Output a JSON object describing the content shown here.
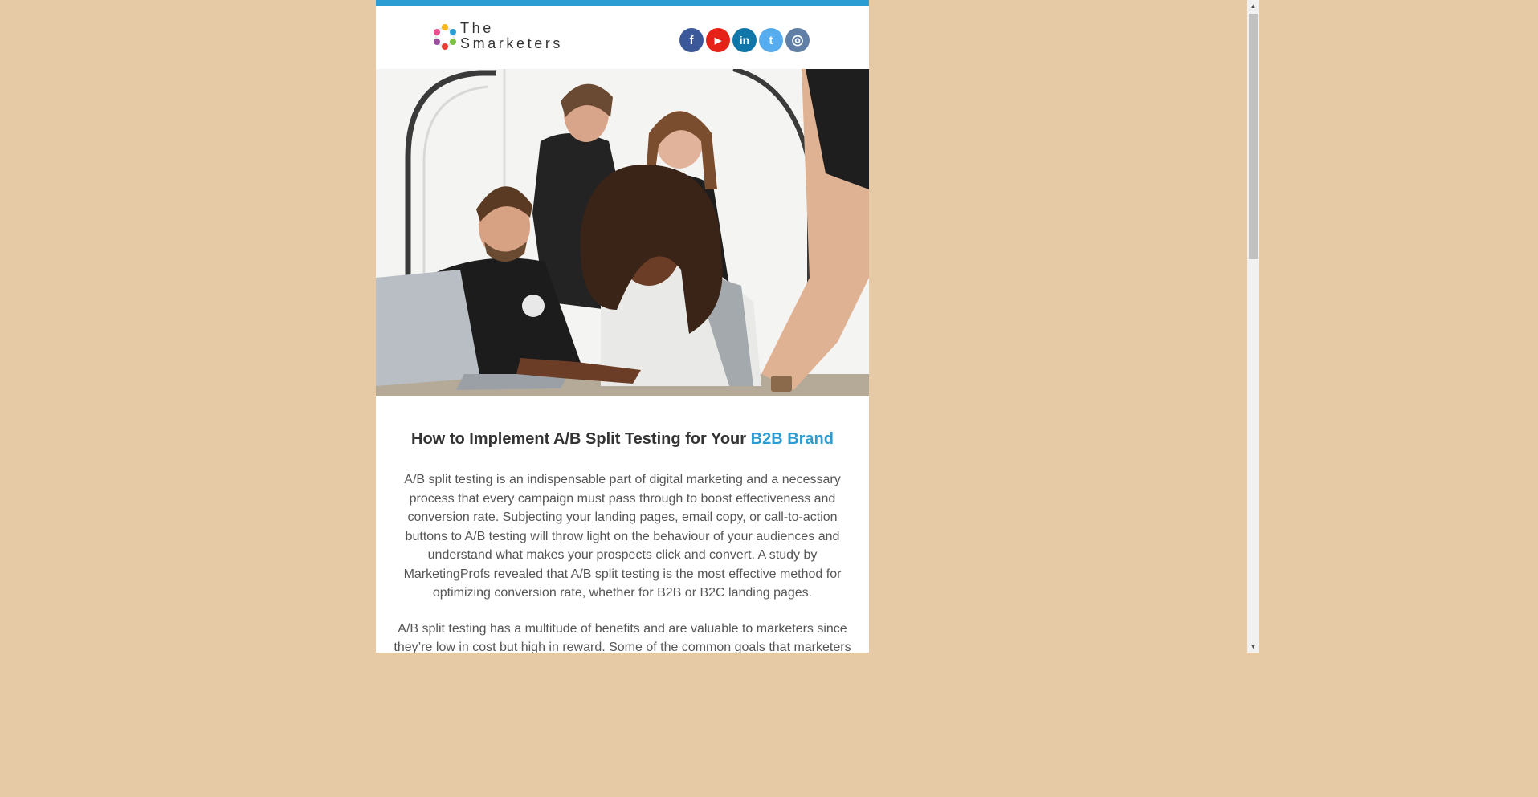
{
  "brand": {
    "line1": "The",
    "line2": "Smarketers"
  },
  "social": [
    {
      "name": "facebook-icon",
      "glyph": "f",
      "color": "#3b5998"
    },
    {
      "name": "youtube-icon",
      "glyph": "▶",
      "color": "#e62117"
    },
    {
      "name": "linkedin-icon",
      "glyph": "in",
      "color": "#0e76a8"
    },
    {
      "name": "twitter-icon",
      "glyph": "t",
      "color": "#55acee"
    },
    {
      "name": "instagram-icon",
      "glyph": "◎",
      "color": "#5f7fa6"
    }
  ],
  "article": {
    "title_main": "How to Implement A/B Split Testing for Your ",
    "title_accent": "B2B Brand",
    "paragraph1": "A/B split testing is an indispensable part of digital marketing and a necessary process that every campaign must pass through to boost effectiveness and conversion rate. Subjecting your landing pages, email copy, or call-to-action buttons to A/B testing will throw light on the behaviour of your audiences and understand what makes your prospects click and convert. A study by MarketingProfs revealed that A/B split testing is the most effective method for optimizing conversion rate, whether for B2B or B2C landing pages.",
    "paragraph2": "A/B split testing has a multitude of benefits and are valuable to marketers since they’re low in cost but high in reward. Some of the common goals that marketers"
  },
  "colors": {
    "accent": "#2b9dd3",
    "page_bg": "#e6caa6"
  }
}
